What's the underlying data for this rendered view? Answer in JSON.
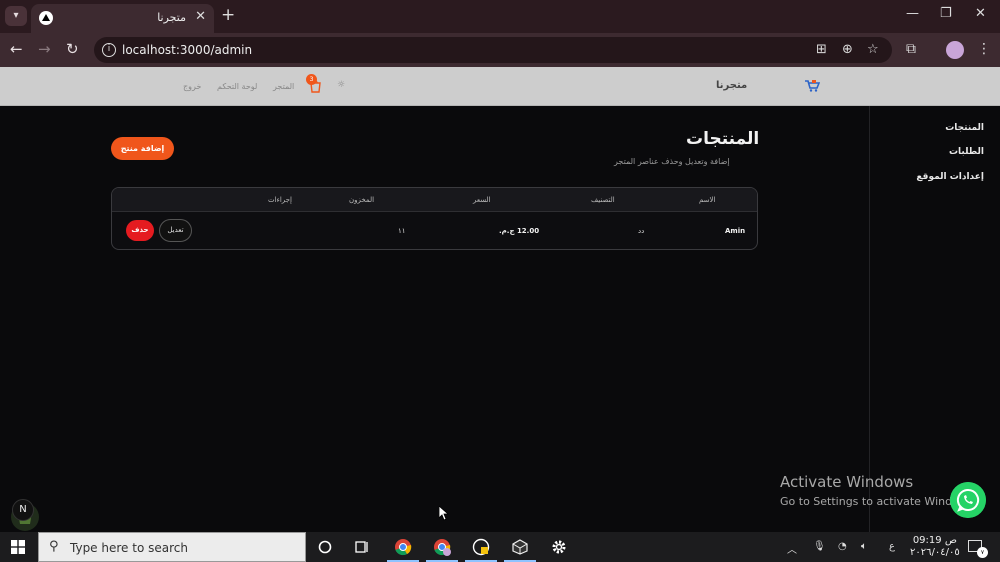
{
  "browser": {
    "tab_title": "متجرنا",
    "url": "localhost:3000/admin"
  },
  "header": {
    "brand": "متجرنا",
    "nav": {
      "store": "المتجر",
      "dashboard": "لوحة التحكم",
      "logout": "خروج"
    },
    "cart_count": "3"
  },
  "sidebar": {
    "items": [
      {
        "label": "المنتجات"
      },
      {
        "label": "الطلبات"
      },
      {
        "label": "إعدادات الموقع"
      }
    ]
  },
  "main": {
    "title": "المنتجات",
    "subtitle": "إضافة وتعديل وحذف عناصر المتجر",
    "add_button": "إضافة منتج",
    "table": {
      "headers": {
        "name": "الاسم",
        "category": "التصنيف",
        "price": "السعر",
        "stock": "المخزون",
        "actions": "إجراءات"
      },
      "rows": [
        {
          "name": "Amin",
          "category": "دد",
          "price": "12.00 ج.م.",
          "stock": "١١",
          "edit": "تعديل",
          "delete": "حذف"
        }
      ]
    }
  },
  "overlay": {
    "activate_title": "Activate Windows",
    "activate_sub": "Go to Settings to activate Windows.",
    "next_badge": "N"
  },
  "taskbar": {
    "search_placeholder": "Type here to search",
    "lang": "ع",
    "time": "09:19 ص",
    "date": "٢٠٢٦/٠٤/٠٥",
    "notif_count": "٧"
  },
  "colors": {
    "accent": "#f0561b",
    "danger": "#e51b20",
    "whatsapp": "#25d366"
  }
}
